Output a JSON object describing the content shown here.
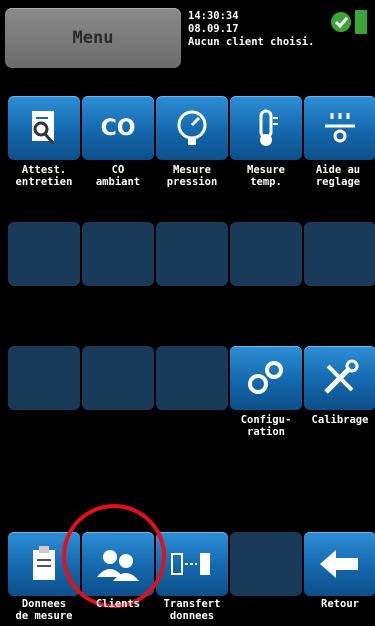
{
  "header": {
    "menu_label": "Menu",
    "time": "14:30:34",
    "date": "08.09.17",
    "client_status": "Aucun client choisi."
  },
  "row1": [
    {
      "label": "Attest.\nentretien",
      "icon": "document-magnifier-icon"
    },
    {
      "label": "CO\nambiant",
      "icon": "co-text-icon",
      "icon_text": "CO"
    },
    {
      "label": "Mesure\npression",
      "icon": "pressure-gauge-icon"
    },
    {
      "label": "Mesure\ntemp.",
      "icon": "thermometer-icon"
    },
    {
      "label": "Aide au\nreglage",
      "icon": "burner-adjust-icon"
    }
  ],
  "row3": [
    {
      "label": "Configu-\nration",
      "icon": "gears-icon"
    },
    {
      "label": "Calibrage",
      "icon": "tools-icon"
    }
  ],
  "bottom": [
    {
      "label": "Donnees\nde mesure",
      "icon": "clipboard-icon"
    },
    {
      "label": "Clients",
      "icon": "users-icon"
    },
    {
      "label": "Transfert\ndonnees",
      "icon": "transfer-icon"
    },
    {
      "label": "Retour",
      "icon": "arrow-left-icon"
    }
  ],
  "colors": {
    "tile": "#1468ad",
    "empty_tile": "#1a3a5a",
    "highlight": "#e3101b",
    "ok": "#3aa635"
  }
}
